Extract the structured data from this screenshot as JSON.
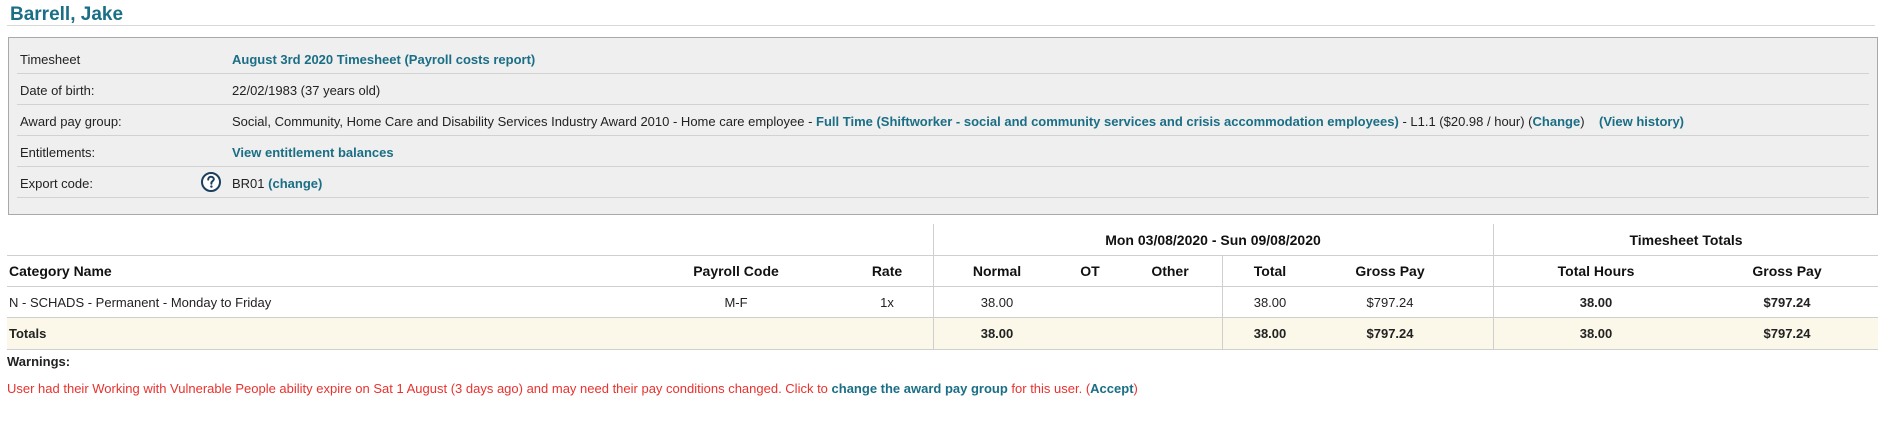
{
  "header": {
    "title": "Barrell, Jake"
  },
  "info": {
    "timesheet": {
      "label": "Timesheet",
      "link": "August 3rd 2020 Timesheet",
      "report_open": "(",
      "report_link": "Payroll costs report",
      "report_close": ")"
    },
    "dob": {
      "label": "Date of birth:",
      "value": "22/02/1983 (37 years old)"
    },
    "award": {
      "label": "Award pay group:",
      "prefix": "Social, Community, Home Care and Disability Services Industry Award 2010 - Home care employee - ",
      "employment_link": "Full Time (Shiftworker - social and community services and crisis accommodation employees)",
      "level": " - L1.1 ($20.98 / hour) (",
      "change_link": "Change",
      "after_change": ")",
      "history_open": "(",
      "history_link": "View history",
      "history_close": ")"
    },
    "entitlements": {
      "label": "Entitlements:",
      "link": "View entitlement balances"
    },
    "export": {
      "label": "Export code:",
      "help_icon": "question-circle-icon",
      "value": "BR01",
      "change_open": "(",
      "change_link": "change",
      "change_close": ")"
    }
  },
  "table": {
    "period_header": "Mon 03/08/2020 - Sun 09/08/2020",
    "totals_header": "Timesheet Totals",
    "columns": {
      "category": "Category Name",
      "payroll_code": "Payroll Code",
      "rate": "Rate",
      "normal": "Normal",
      "ot": "OT",
      "other": "Other",
      "total": "Total",
      "gross_pay": "Gross Pay",
      "total_hours": "Total Hours",
      "gross_pay_totals": "Gross Pay"
    },
    "rows": [
      {
        "category": "N - SCHADS - Permanent - Monday to Friday",
        "payroll_code": "M-F",
        "rate": "1x",
        "normal": "38.00",
        "ot": "",
        "other": "",
        "total": "38.00",
        "gross_pay": "$797.24",
        "total_hours": "38.00",
        "gross_pay_totals": "$797.24"
      }
    ],
    "totals": {
      "label": "Totals",
      "normal": "38.00",
      "total": "38.00",
      "gross_pay": "$797.24",
      "total_hours": "38.00",
      "gross_pay_totals": "$797.24"
    }
  },
  "warnings": {
    "title": "Warnings:",
    "message_pre": "User had their Working with Vulnerable People ability expire on Sat 1 August (3 days ago) and may need their pay conditions changed. Click to ",
    "message_link": "change the award pay group",
    "message_post": " for this user. (",
    "accept_link": "Accept",
    "message_end": ")"
  },
  "colors": {
    "link": "#1a6e85",
    "warning": "#e8322e",
    "panel_bg": "#efefef",
    "totals_bg": "#fbf8e9"
  }
}
